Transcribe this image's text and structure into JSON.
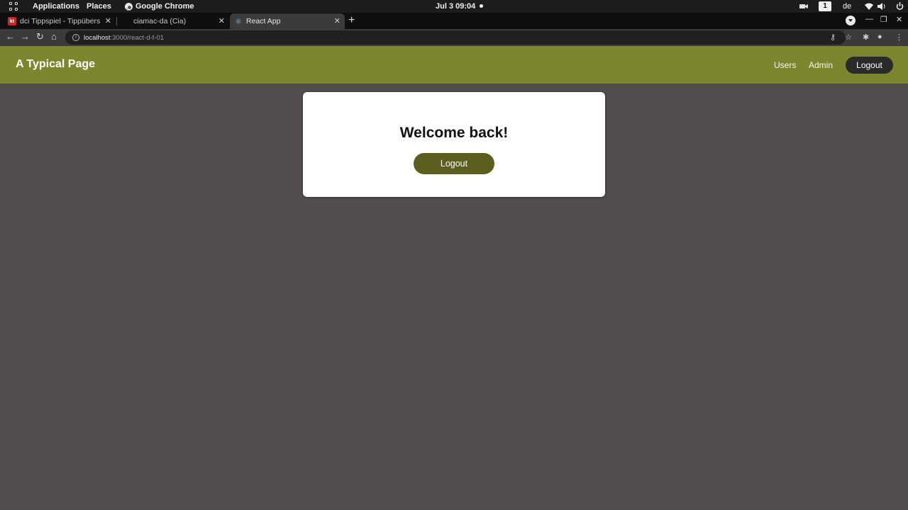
{
  "os_bar": {
    "applications": "Applications",
    "places": "Places",
    "active_app": "Google Chrome",
    "clock": "Jul 3  09:04",
    "workspace": "1",
    "language": "de"
  },
  "browser": {
    "tabs": [
      {
        "title": "dci Tippspiel - Tippübersi",
        "favicon_text": "kt",
        "active": false
      },
      {
        "title": "ciamac-da (Cia)",
        "active": false
      },
      {
        "title": "React App",
        "active": true
      }
    ],
    "url_host": "localhost",
    "url_path": ":3000/react-d-f-01"
  },
  "header": {
    "title": "A Typical Page",
    "nav": {
      "users": "Users",
      "admin": "Admin"
    },
    "logout_label": "Logout",
    "color": "#7e862d"
  },
  "card": {
    "heading": "Welcome back!",
    "logout_label": "Logout",
    "button_color": "#5b5e1f"
  },
  "page": {
    "background": "#524e4e"
  }
}
